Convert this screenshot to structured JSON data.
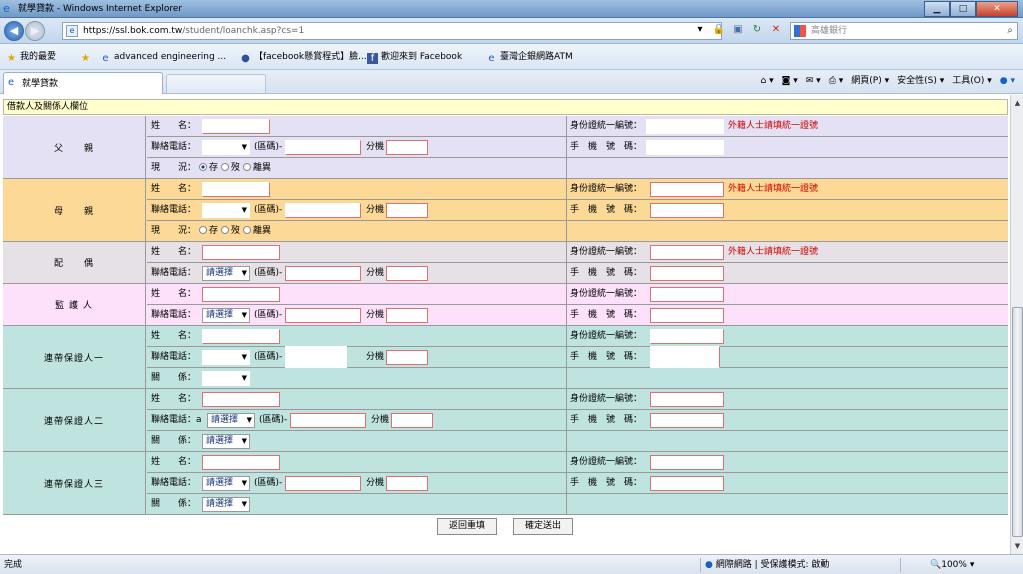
{
  "window": {
    "title": "就學貸款 - Windows Internet Explorer",
    "min": "▁",
    "max": "□",
    "close": "✕"
  },
  "address": {
    "url_host": "https://ssl.bok.com.tw",
    "url_path": "/student/loanchk.asp?cs=1",
    "search_placeholder": "高雄銀行",
    "back_glyph": "◀",
    "fwd_glyph": "▶"
  },
  "favorites": {
    "label": "我的最愛",
    "items": [
      "advanced engineering ...",
      "【facebook懸賞程式】臉...",
      "歡迎來到 Facebook",
      "臺灣企銀網路ATM"
    ]
  },
  "tab": {
    "label": "就學貸款"
  },
  "command_bar": {
    "page": "網頁(P)",
    "safety": "安全性(S)",
    "tools": "工具(O)"
  },
  "form": {
    "section_title": "借款人及關係人欄位",
    "labels": {
      "name": "姓　　名：",
      "phone": "聯絡電話：",
      "area": "(區碼)-",
      "ext": "分機",
      "status": "現　　況：",
      "id": "身份證統一編號：",
      "mobile": "手　機　號　碼：",
      "relation": "關　　係：",
      "foreign_note": "外籍人士請填統一證號",
      "select_default": "請選擇"
    },
    "status_options": [
      "存",
      "歿",
      "離異"
    ],
    "groups": {
      "father": "父　　親",
      "mother": "母　　親",
      "spouse": "配　　偶",
      "guardian": "監 護 人",
      "guarantor1": "連帶保證人一",
      "guarantor2": "連帶保證人二",
      "guarantor3": "連帶保證人三"
    },
    "guarantor2_phone_prefix": "a"
  },
  "buttons": {
    "back": "返回重填",
    "submit": "確定送出"
  },
  "status": {
    "done": "完成",
    "zone": "網際網路 | 受保護模式: 啟動",
    "zoom": "100%"
  },
  "colors": {
    "header": "#ffffcc",
    "father": "#e5e1f4",
    "mother": "#fcd997",
    "spouse": "#e6e1e6",
    "guardian": "#fde0fa",
    "guarantor": "#bfe3df",
    "note": "#d40000"
  },
  "icons": {
    "ie": "internet-explorer-icon",
    "lock": "lock-icon",
    "refresh": "refresh-icon",
    "stop": "stop-icon",
    "search": "search-icon",
    "star": "favorites-star-icon",
    "globe": "internet-zone-icon",
    "zoom": "zoom-icon"
  }
}
